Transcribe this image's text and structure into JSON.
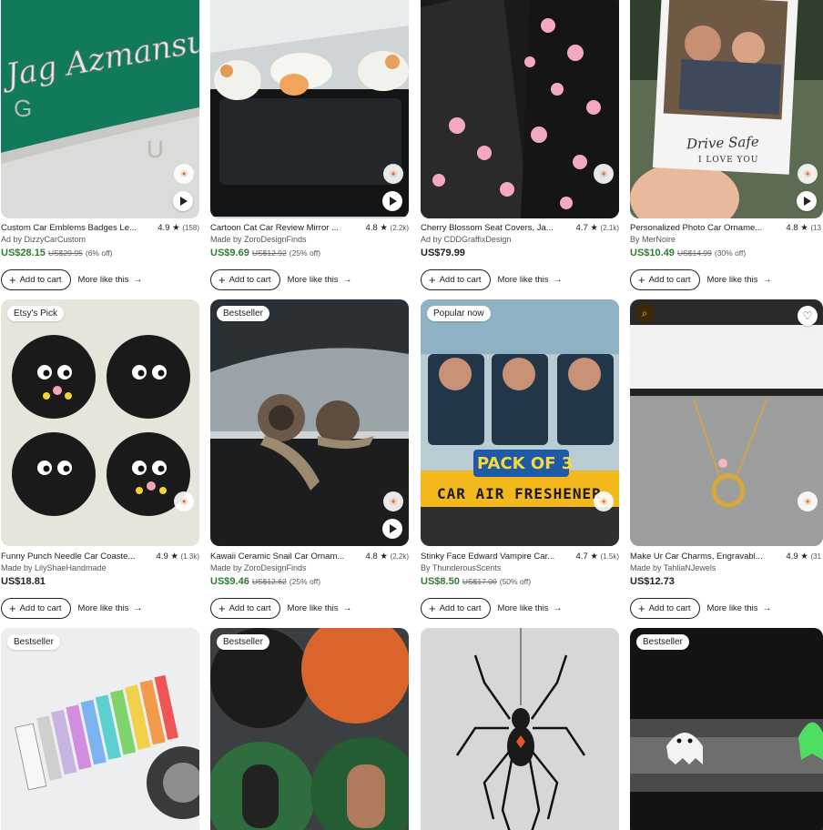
{
  "colors": {
    "sale_price": "#2e7d32",
    "text": "#222222",
    "muted": "#555555"
  },
  "labels": {
    "add_to_cart": "Add to cart",
    "more_like_this": "More like this"
  },
  "products": [
    {
      "title": "Custom Car Emblems Badges Le...",
      "rating": "4.9 ★",
      "reviews": "(158)",
      "seller": "Ad by DizzyCarCustom",
      "price": "US$28.15",
      "orig_price": "US$29.95",
      "discount": "(6% off)",
      "badge": ""
    },
    {
      "title": "Cartoon Cat Car Review Mirror ...",
      "rating": "4.8 ★",
      "reviews": "(2.2k)",
      "seller": "Made by ZoroDesignFinds",
      "price": "US$9.69",
      "orig_price": "US$12.92",
      "discount": "(25% off)",
      "badge": ""
    },
    {
      "title": "Cherry Blossom Seat Covers, Ja...",
      "rating": "4.7 ★",
      "reviews": "(2.1k)",
      "seller": "Ad by CDDGraffixDesign",
      "price": "US$79.99",
      "orig_price": "",
      "discount": "",
      "badge": ""
    },
    {
      "title": "Personalized Photo Car Orname...",
      "rating": "4.8 ★",
      "reviews": "(13",
      "seller": "By MerNoire",
      "price": "US$10.49",
      "orig_price": "US$14.99",
      "discount": "(30% off)",
      "badge": "",
      "photo_text_1": "Drive Safe",
      "photo_text_2": "I LOVE YOU"
    },
    {
      "title": "Funny Punch Needle Car Coaste...",
      "rating": "4.9 ★",
      "reviews": "(1.3k)",
      "seller": "Made by LilyShaeHandmade",
      "price": "US$18.81",
      "orig_price": "",
      "discount": "",
      "badge": "Etsy's Pick"
    },
    {
      "title": "Kawaii Ceramic Snail Car Ornam...",
      "rating": "4.8 ★",
      "reviews": "(2.2k)",
      "seller": "Made by ZoroDesignFinds",
      "price": "US$9.46",
      "orig_price": "US$12.62",
      "discount": "(25% off)",
      "badge": "Bestseller"
    },
    {
      "title": "Stinky Face Edward Vampire Car...",
      "rating": "4.7 ★",
      "reviews": "(1.5k)",
      "seller": "By ThunderousScents",
      "price": "US$8.50",
      "orig_price": "US$17.00",
      "discount": "(50% off)",
      "badge": "Popular now",
      "banner_1": "PACK OF 3",
      "banner_2": "CAR AIR FRESHENER"
    },
    {
      "title": "Make Ur Car Charms, Engravabl...",
      "rating": "4.9 ★",
      "reviews": "(31",
      "seller": "Made by TahliaNJewels",
      "price": "US$12.73",
      "orig_price": "",
      "discount": "",
      "badge": ""
    },
    {
      "badge": "Bestseller"
    },
    {
      "badge": "Bestseller"
    },
    {
      "badge": ""
    },
    {
      "badge": "Bestseller"
    }
  ]
}
